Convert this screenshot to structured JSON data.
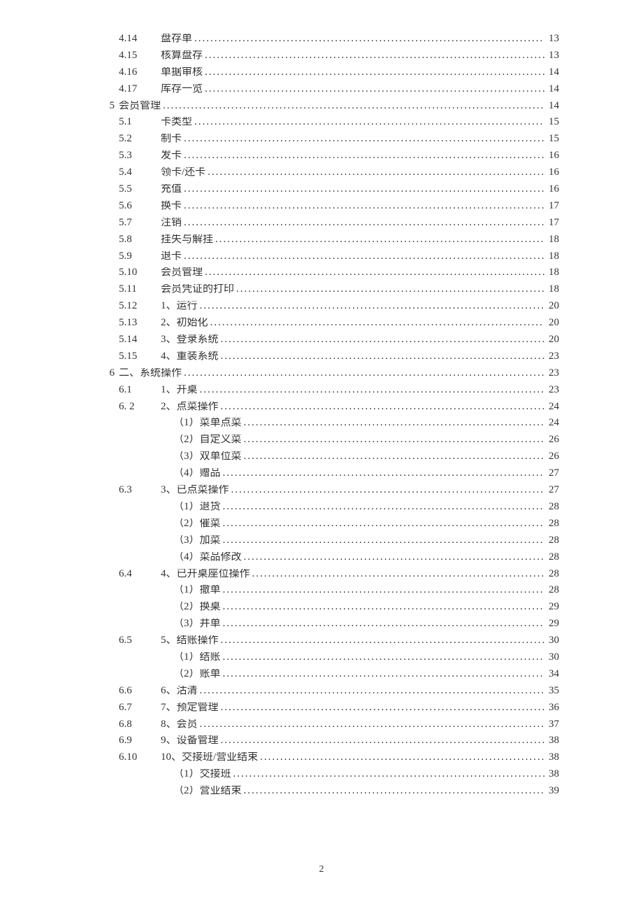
{
  "page_number": "2",
  "entries": [
    {
      "chapter": "",
      "num": "4.14",
      "title": "盘存单",
      "page": "13",
      "level": "sub"
    },
    {
      "chapter": "",
      "num": "4.15",
      "title": "核算盘存",
      "page": "13",
      "level": "sub"
    },
    {
      "chapter": "",
      "num": "4.16",
      "title": "单据审核",
      "page": "14",
      "level": "sub"
    },
    {
      "chapter": "",
      "num": "4.17",
      "title": "库存一览",
      "page": "14",
      "level": "sub"
    },
    {
      "chapter": "5",
      "num": "",
      "title": "会员管理",
      "page": "14",
      "level": "chap"
    },
    {
      "chapter": "",
      "num": "5.1",
      "title": "卡类型",
      "page": "15",
      "level": "sub"
    },
    {
      "chapter": "",
      "num": "5.2",
      "title": "制卡",
      "page": "15",
      "level": "sub"
    },
    {
      "chapter": "",
      "num": "5.3",
      "title": "发卡",
      "page": "16",
      "level": "sub"
    },
    {
      "chapter": "",
      "num": "5.4",
      "title": "领卡/还卡",
      "page": "16",
      "level": "sub"
    },
    {
      "chapter": "",
      "num": "5.5",
      "title": "充值",
      "page": "16",
      "level": "sub"
    },
    {
      "chapter": "",
      "num": "5.6",
      "title": "换卡",
      "page": "17",
      "level": "sub"
    },
    {
      "chapter": "",
      "num": "5.7",
      "title": "注销",
      "page": "17",
      "level": "sub"
    },
    {
      "chapter": "",
      "num": "5.8",
      "title": "挂失与解挂",
      "page": "18",
      "level": "sub"
    },
    {
      "chapter": "",
      "num": "5.9",
      "title": "退卡",
      "page": "18",
      "level": "sub"
    },
    {
      "chapter": "",
      "num": "5.10",
      "title": "会员管理",
      "page": "18",
      "level": "sub"
    },
    {
      "chapter": "",
      "num": "5.11",
      "title": "会员凭证的打印",
      "page": "18",
      "level": "sub"
    },
    {
      "chapter": "",
      "num": "5.12",
      "title": "1、运行",
      "page": "20",
      "level": "sub"
    },
    {
      "chapter": "",
      "num": "5.13",
      "title": "2、初始化",
      "page": "20",
      "level": "sub"
    },
    {
      "chapter": "",
      "num": "5.14",
      "title": "3、登录系统",
      "page": "20",
      "level": "sub"
    },
    {
      "chapter": "",
      "num": "5.15",
      "title": "4、重装系统",
      "page": "23",
      "level": "sub"
    },
    {
      "chapter": "6",
      "num": "",
      "title": "二、系统操作",
      "page": "23",
      "level": "chap"
    },
    {
      "chapter": "",
      "num": "6.1",
      "title": "1、开桌",
      "page": "23",
      "level": "sub"
    },
    {
      "chapter": "",
      "num": "6. 2",
      "title": "2、点菜操作",
      "page": "24",
      "level": "sub"
    },
    {
      "chapter": "",
      "num": "",
      "title": "（1）菜单点菜",
      "page": "24",
      "level": "sub2"
    },
    {
      "chapter": "",
      "num": "",
      "title": "（2）自定义菜",
      "page": "26",
      "level": "sub2"
    },
    {
      "chapter": "",
      "num": "",
      "title": "（3）双单位菜",
      "page": "26",
      "level": "sub2"
    },
    {
      "chapter": "",
      "num": "",
      "title": "（4）赠品",
      "page": "27",
      "level": "sub2"
    },
    {
      "chapter": "",
      "num": "6.3",
      "title": "3、已点菜操作",
      "page": "27",
      "level": "sub"
    },
    {
      "chapter": "",
      "num": "",
      "title": "（1）退货",
      "page": "28",
      "level": "sub2"
    },
    {
      "chapter": "",
      "num": "",
      "title": "（2）催菜",
      "page": "28",
      "level": "sub2"
    },
    {
      "chapter": "",
      "num": "",
      "title": "（3）加菜",
      "page": "28",
      "level": "sub2"
    },
    {
      "chapter": "",
      "num": "",
      "title": "（4）菜品修改",
      "page": "28",
      "level": "sub2"
    },
    {
      "chapter": "",
      "num": "6.4",
      "title": "4、已开桌座位操作",
      "page": "28",
      "level": "sub"
    },
    {
      "chapter": "",
      "num": "",
      "title": "（1）撤单",
      "page": "28",
      "level": "sub2"
    },
    {
      "chapter": "",
      "num": "",
      "title": "（2）换桌",
      "page": "29",
      "level": "sub2"
    },
    {
      "chapter": "",
      "num": "",
      "title": "（3）并单",
      "page": "29",
      "level": "sub2"
    },
    {
      "chapter": "",
      "num": "6.5",
      "title": "5、结账操作",
      "page": "30",
      "level": "sub"
    },
    {
      "chapter": "",
      "num": "",
      "title": "（1）结账",
      "page": "30",
      "level": "sub2"
    },
    {
      "chapter": "",
      "num": "",
      "title": "（2）账单",
      "page": "34",
      "level": "sub2"
    },
    {
      "chapter": "",
      "num": "6.6",
      "title": "6、沽清",
      "page": "35",
      "level": "sub"
    },
    {
      "chapter": "",
      "num": "6.7",
      "title": "7、预定管理",
      "page": "36",
      "level": "sub"
    },
    {
      "chapter": "",
      "num": "6.8",
      "title": "8、会员",
      "page": "37",
      "level": "sub"
    },
    {
      "chapter": "",
      "num": "6.9",
      "title": "9、设备管理",
      "page": "38",
      "level": "sub"
    },
    {
      "chapter": "",
      "num": "6.10",
      "title": "10、交接班/营业结束",
      "page": "38",
      "level": "sub"
    },
    {
      "chapter": "",
      "num": "",
      "title": "（1）交接班",
      "page": "38",
      "level": "sub2"
    },
    {
      "chapter": "",
      "num": "",
      "title": "（2）营业结束",
      "page": "39",
      "level": "sub2"
    }
  ]
}
